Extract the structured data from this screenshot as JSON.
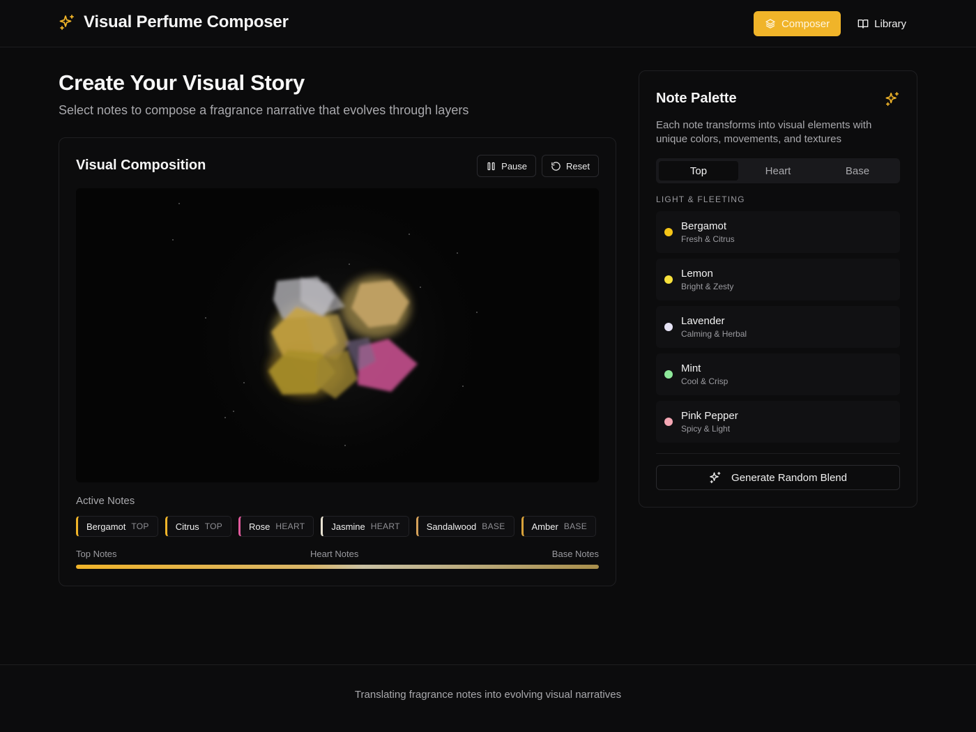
{
  "header": {
    "title": "Visual Perfume Composer",
    "brand_icon": "sparkles-icon",
    "nav": [
      {
        "label": "Composer",
        "icon": "layers-icon",
        "active": true
      },
      {
        "label": "Library",
        "icon": "book-open-icon",
        "active": false
      }
    ]
  },
  "hero": {
    "title": "Create Your Visual Story",
    "subtitle": "Select notes to compose a fragrance narrative that evolves through layers"
  },
  "composition": {
    "title": "Visual Composition",
    "pause_label": "Pause",
    "reset_label": "Reset",
    "active_notes_label": "Active Notes",
    "active_notes": [
      {
        "name": "Bergamot",
        "tier": "TOP",
        "color": "#f0b429"
      },
      {
        "name": "Citrus",
        "tier": "TOP",
        "color": "#f0b429"
      },
      {
        "name": "Rose",
        "tier": "HEART",
        "color": "#e05a9c"
      },
      {
        "name": "Jasmine",
        "tier": "HEART",
        "color": "#e8e2d2"
      },
      {
        "name": "Sandalwood",
        "tier": "BASE",
        "color": "#d4a15a"
      },
      {
        "name": "Amber",
        "tier": "BASE",
        "color": "#d9a23a"
      }
    ],
    "progress_labels": [
      "Top Notes",
      "Heart Notes",
      "Base Notes"
    ]
  },
  "palette": {
    "title": "Note Palette",
    "icon": "sparkles-icon",
    "description": "Each note transforms into visual elements with unique colors, movements, and textures",
    "tabs": [
      {
        "label": "Top",
        "active": true
      },
      {
        "label": "Heart",
        "active": false
      },
      {
        "label": "Base",
        "active": false
      }
    ],
    "section_label": "LIGHT & FLEETING",
    "notes": [
      {
        "name": "Bergamot",
        "desc": "Fresh & Citrus",
        "color": "#f5c518"
      },
      {
        "name": "Lemon",
        "desc": "Bright & Zesty",
        "color": "#f7e13c"
      },
      {
        "name": "Lavender",
        "desc": "Calming & Herbal",
        "color": "#e6e3f5"
      },
      {
        "name": "Mint",
        "desc": "Cool & Crisp",
        "color": "#8ee89a"
      },
      {
        "name": "Pink Pepper",
        "desc": "Spicy & Light",
        "color": "#f4a7b4"
      }
    ],
    "generate_label": "Generate Random Blend"
  },
  "footer": {
    "text": "Translating fragrance notes into evolving visual narratives"
  },
  "colors": {
    "accent": "#f0b429",
    "background": "#0b0b0c"
  }
}
